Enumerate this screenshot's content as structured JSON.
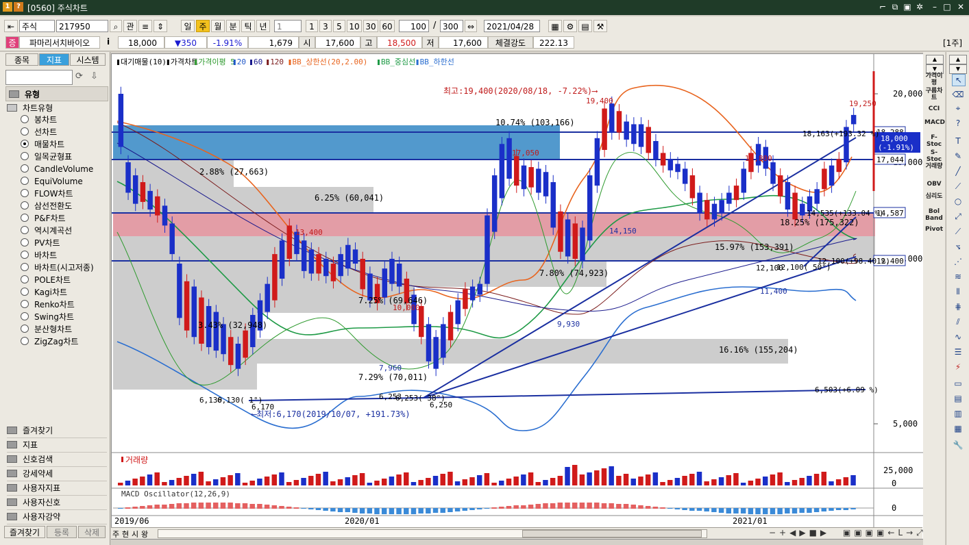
{
  "window": {
    "title": "[0560] 주식차트",
    "icons": [
      "1",
      "?"
    ]
  },
  "toolbar": {
    "market": "주식",
    "code": "217950",
    "gwan_label": "관",
    "periods": [
      "일",
      "주",
      "월",
      "분",
      "틱",
      "년"
    ],
    "active_period": "주",
    "interval_value": "1",
    "quick_intervals": [
      "1",
      "3",
      "5",
      "10",
      "30",
      "60"
    ],
    "count_value": "100",
    "count_sep": "/",
    "count_total": "300",
    "date": "2021/04/28"
  },
  "quote": {
    "badge": "증",
    "name": "파마리서치바이오",
    "info_icon": "i",
    "price": "18,000",
    "change": "▼350",
    "change_pct": "-1.91%",
    "volume": "1,679",
    "open_label": "시",
    "open": "17,600",
    "high_label": "고",
    "high": "18,500",
    "low_label": "저",
    "low": "17,600",
    "strength_label": "체결강도",
    "strength": "222.13",
    "week_label": "[1주]"
  },
  "left": {
    "tabs": [
      "종목",
      "지표",
      "시스템"
    ],
    "active_tab": "지표",
    "section_title": "유형",
    "group_title": "차트유형",
    "chart_types": [
      "봉차트",
      "선차트",
      "매물차트",
      "일목균형표",
      "CandleVolume",
      "EquiVolume",
      "FLOW차트",
      "삼선전환도",
      "P&F차트",
      "역시계곡선",
      "PV차트",
      "바차트",
      "바차트(시고저종)",
      "POLE차트",
      "Kagi차트",
      "Renko차트",
      "Swing차트",
      "분산형차트",
      "ZigZag차트"
    ],
    "selected_type": "매물차트",
    "categories": [
      "즐겨찾기",
      "지표",
      "신호검색",
      "강세약세",
      "사용자지표",
      "사용자신호",
      "사용자강약"
    ],
    "bottom_tabs": [
      "즐겨찾기",
      "등록",
      "삭제"
    ]
  },
  "legend": [
    {
      "text": "대기매물(10)",
      "color": "#000000"
    },
    {
      "text": "가격차트",
      "color": "#000000"
    },
    {
      "text": "가격이평 5",
      "color": "#2e9a2e"
    },
    {
      "text": "20",
      "color": "#1e56c8"
    },
    {
      "text": "60",
      "color": "#1a1a8c"
    },
    {
      "text": "120",
      "color": "#7a1a1a"
    },
    {
      "text": "BB_상한선(20,2.00)",
      "color": "#e8641e"
    },
    {
      "text": "BB_중심선",
      "color": "#1e9a46"
    },
    {
      "text": "BB_하한선",
      "color": "#2a6ed0"
    }
  ],
  "price_axis": {
    "ticks": [
      "20,000",
      "15,000",
      "10,000",
      "5,000"
    ],
    "right_labels": [
      "18,288",
      "17,044",
      "14,587",
      "12,400"
    ],
    "current_tag": [
      "18,000",
      "(-1.91%)"
    ]
  },
  "annotations": {
    "high_note": "최고:19,400(2020/08/18, -7.22%)⟶",
    "low_note": "⟵최저:6,170(2019/10/07, +191.73%)",
    "profile_labels": [
      "10.74% (103,166)",
      "2.88% (27,663)",
      "6.25% (60,041)",
      "18.25% (175,322)",
      "15.97% (153,391)",
      "7.80% (74,923)",
      "7.25% (69,646)",
      "3.43% (32,948)",
      "7.29% (70,011)",
      "16.16% (155,204)"
    ],
    "price_labels": [
      "19,400",
      "19,250",
      "17,050",
      "16,800",
      "14,150",
      "13,400",
      "10,000",
      "9,930",
      "12,100",
      "11,400",
      "7,960",
      "6,130",
      "6,170",
      "6,250",
      "6,253"
    ],
    "trend_labels": [
      "18,163(+193.32 %)",
      "14,535(+133.04 %)",
      "12,100(+98.40 %)",
      "6,503(+6.09 %)",
      "12,100( 50°)",
      "6,130( 1°)",
      "6,253( 38°)"
    ]
  },
  "volume_panel": {
    "title": "거래량",
    "ticks": [
      "25,000",
      "0"
    ]
  },
  "macd_panel": {
    "title": "MACD Oscillator(12,26,9)",
    "ticks": [
      "0"
    ]
  },
  "x_axis": {
    "labels": [
      "2019/06",
      "2020/01",
      "2021/01"
    ]
  },
  "scroll": {
    "labels": [
      "주",
      "현",
      "시",
      "왕"
    ]
  },
  "right_indicators": [
    "가격이평",
    "구름차트",
    "CCI",
    "MACD",
    "F-Stoc",
    "S-Stoc",
    "거래량",
    "OBV",
    "심리도",
    "Bol Band",
    "Pivot"
  ]
}
